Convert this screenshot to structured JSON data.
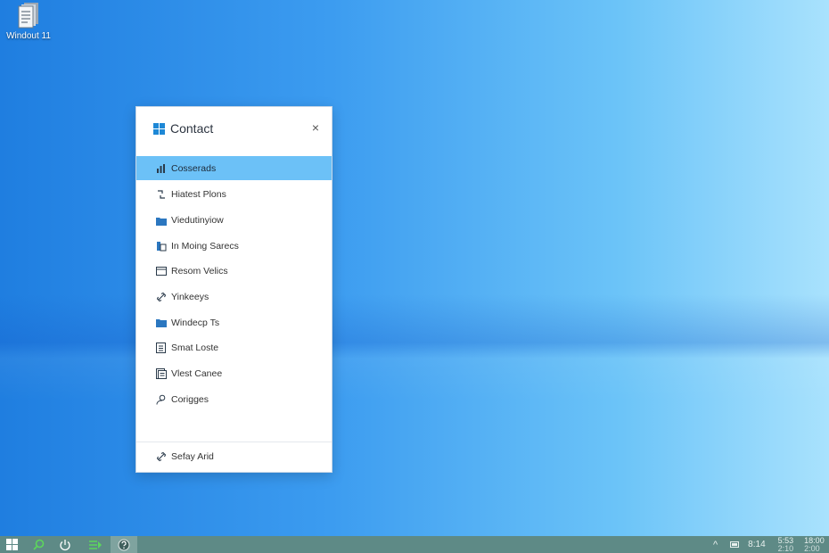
{
  "desktop": {
    "icon_label": "Windout 11"
  },
  "window": {
    "title": "Contact",
    "close_glyph": "×",
    "menu_items": [
      {
        "label": "Cosserads",
        "icon": "chart-icon",
        "active": true
      },
      {
        "label": "Hiatest Plons",
        "icon": "link-icon",
        "active": false
      },
      {
        "label": "Viedutinyiow",
        "icon": "folder-icon",
        "active": false
      },
      {
        "label": "In Moing Sarecs",
        "icon": "folder-icon",
        "active": false
      },
      {
        "label": "Resom Velics",
        "icon": "window-icon",
        "active": false
      },
      {
        "label": "Yinkeeys",
        "icon": "link-icon",
        "active": false
      },
      {
        "label": "Windecp Ts",
        "icon": "folder-icon",
        "active": false
      },
      {
        "label": "Smat Loste",
        "icon": "document-icon",
        "active": false
      },
      {
        "label": "Vlest Canee",
        "icon": "notes-icon",
        "active": false
      },
      {
        "label": "Corigges",
        "icon": "person-icon",
        "active": false
      }
    ],
    "footer_item": {
      "label": "Sefay Arid",
      "icon": "link-icon"
    }
  },
  "taskbar": {
    "buttons": [
      "windows-start-icon",
      "search-icon",
      "power-icon",
      "list-icon",
      "help-icon"
    ],
    "tray": {
      "clock1": "8:14",
      "time_top": "5:53",
      "time_bottom": "2:10",
      "date_top": "18:00",
      "date_bottom": "2:00"
    }
  },
  "colors": {
    "accent_selected": "#6cc1f7",
    "taskbar": "#5e8a86",
    "windows_blue": "#1e88d6"
  }
}
